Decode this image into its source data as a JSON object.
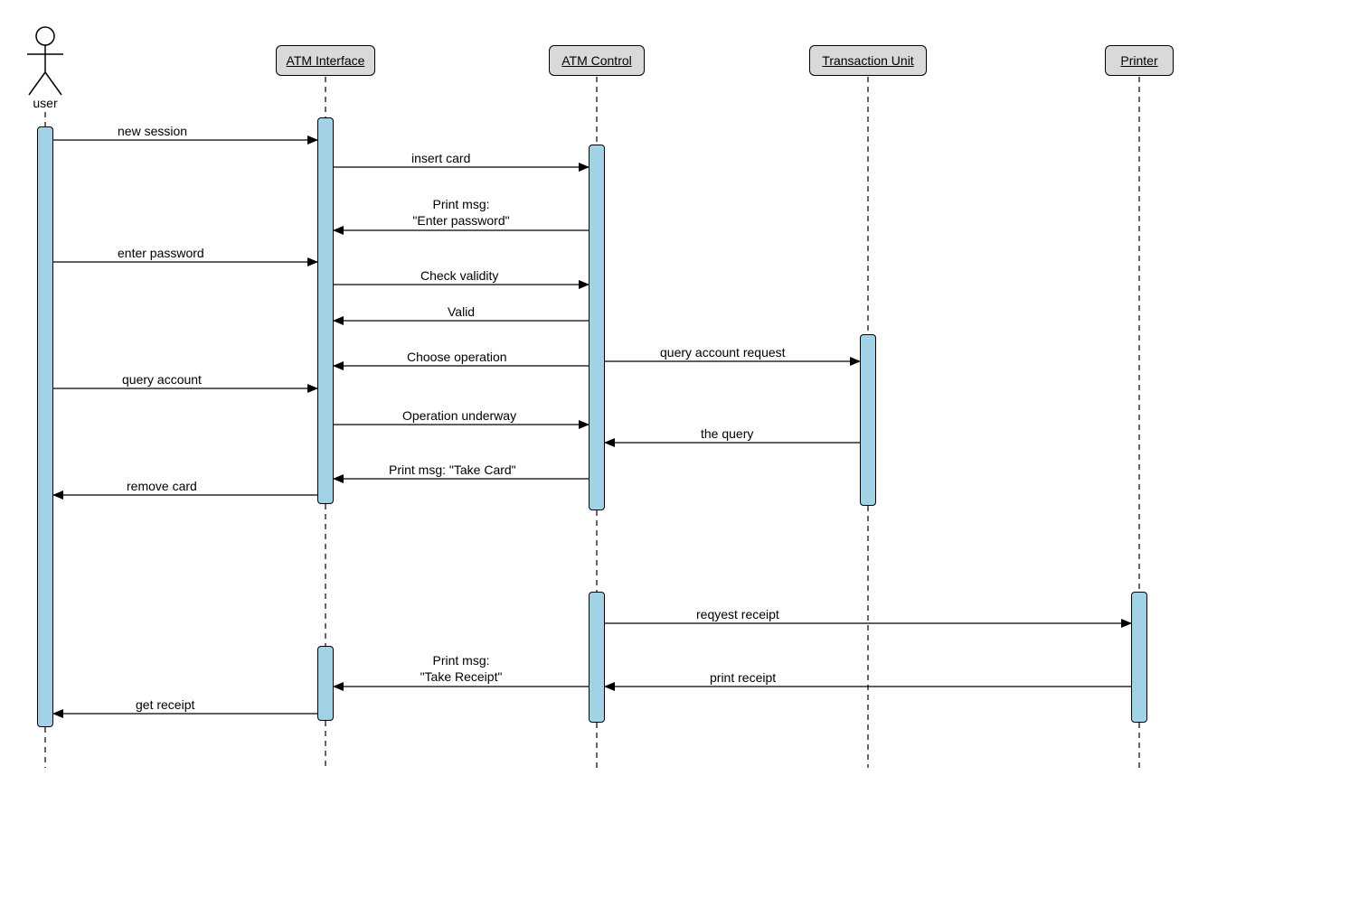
{
  "actor": {
    "label": "user"
  },
  "participants": {
    "atm_interface": "ATM Interface",
    "atm_control": "ATM Control",
    "transaction_unit": "Transaction Unit",
    "printer": "Printer"
  },
  "messages": {
    "new_session": "new session",
    "insert_card": "insert card",
    "enter_password_prompt_l1": "Print msg:",
    "enter_password_prompt_l2": "\"Enter password\"",
    "enter_password": "enter password",
    "check_validity": "Check validity",
    "valid": "Valid",
    "query_account_request": "query account request",
    "choose_operation": "Choose operation",
    "query_account": "query account",
    "operation_underway": "Operation underway",
    "the_query": "the query",
    "take_card_prompt": "Print msg: \"Take Card\"",
    "remove_card": "remove card",
    "request_receipt": "reqyest receipt",
    "take_receipt_prompt_l1": "Print msg:",
    "take_receipt_prompt_l2": "\"Take Receipt\"",
    "print_receipt": "print receipt",
    "get_receipt": "get receipt"
  }
}
